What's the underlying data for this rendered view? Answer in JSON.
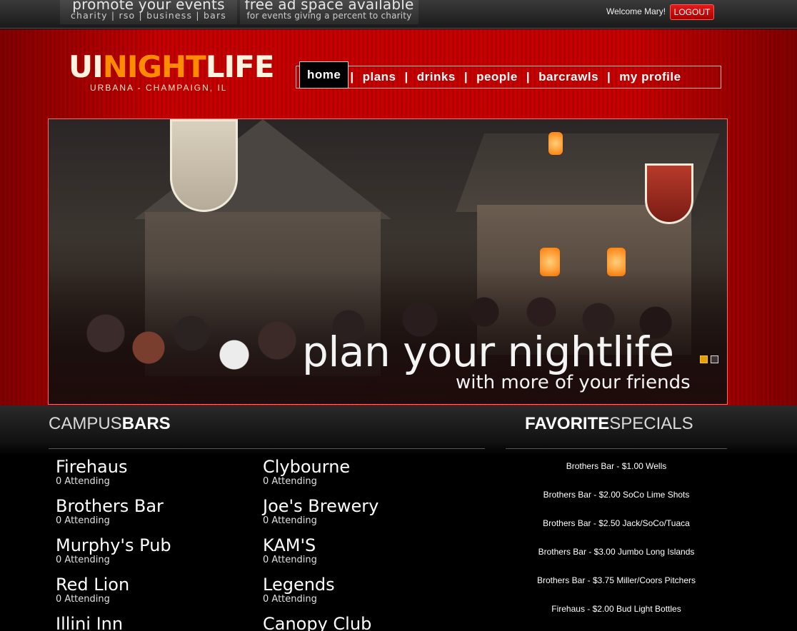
{
  "topbar": {
    "promo1": {
      "title": "promote your events",
      "subtitle": "charity  |  rso  |  business  |  bars"
    },
    "promo2": {
      "title": "free ad space available",
      "subtitle": "for events giving a percent to charity"
    },
    "welcome": "Welcome Mary!",
    "logout_label": "LOGOUT",
    "logout_color": "#d40000"
  },
  "logo": {
    "part1": "UI",
    "part2": "NIGHT",
    "part3": "LIFE",
    "tagline": "URBANA - CHAMPAIGN, IL",
    "accent": "#ff8c00"
  },
  "nav": {
    "items": [
      {
        "label": "home",
        "active": true
      },
      {
        "label": "plans"
      },
      {
        "label": "drinks"
      },
      {
        "label": "people"
      },
      {
        "label": "barcrawls"
      },
      {
        "label": "my profile"
      }
    ],
    "separator": "|"
  },
  "hero": {
    "title": "plan your nightlife",
    "subtitle": "with more of your friends",
    "slide_current": 1,
    "slide_count": 2
  },
  "campus_bars": {
    "title_light": "CAMPUS",
    "title_bold": "BARS",
    "bars": [
      {
        "name": "Firehaus",
        "attending": "0 Attending"
      },
      {
        "name": "Clybourne",
        "attending": "0 Attending"
      },
      {
        "name": "Brothers Bar",
        "attending": "0 Attending"
      },
      {
        "name": "Joe's Brewery",
        "attending": "0 Attending"
      },
      {
        "name": "Murphy's Pub",
        "attending": "0 Attending"
      },
      {
        "name": "KAM'S",
        "attending": "0 Attending"
      },
      {
        "name": "Red Lion",
        "attending": "0 Attending"
      },
      {
        "name": "Legends",
        "attending": "0 Attending"
      },
      {
        "name": "Illini Inn",
        "attending": ""
      },
      {
        "name": "Canopy Club",
        "attending": ""
      }
    ]
  },
  "favorite_specials": {
    "title_bold": "FAVORITE",
    "title_light": "SPECIALS",
    "items": [
      "Brothers Bar - $1.00 Wells",
      "Brothers Bar - $2.00 SoCo Lime Shots",
      "Brothers Bar - $2.50 Jack/SoCo/Tuaca",
      "Brothers Bar - $3.00 Jumbo Long Islands",
      "Brothers Bar - $3.75 Miller/Coors Pitchers",
      "Firehaus - $2.00 Bud Light Bottles"
    ]
  },
  "colors": {
    "header_red": "#c80000",
    "background": "#000000"
  }
}
